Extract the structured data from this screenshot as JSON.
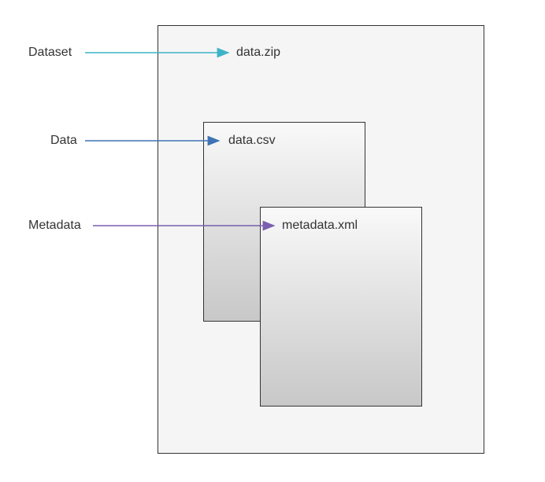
{
  "labels": {
    "dataset": "Dataset",
    "data": "Data",
    "metadata": "Metadata"
  },
  "files": {
    "zip": "data.zip",
    "csv": "data.csv",
    "xml": "metadata.xml"
  },
  "arrows": {
    "dataset_color": "#3cb4c6",
    "data_color": "#3e74b3",
    "metadata_color": "#7a5eb0"
  }
}
